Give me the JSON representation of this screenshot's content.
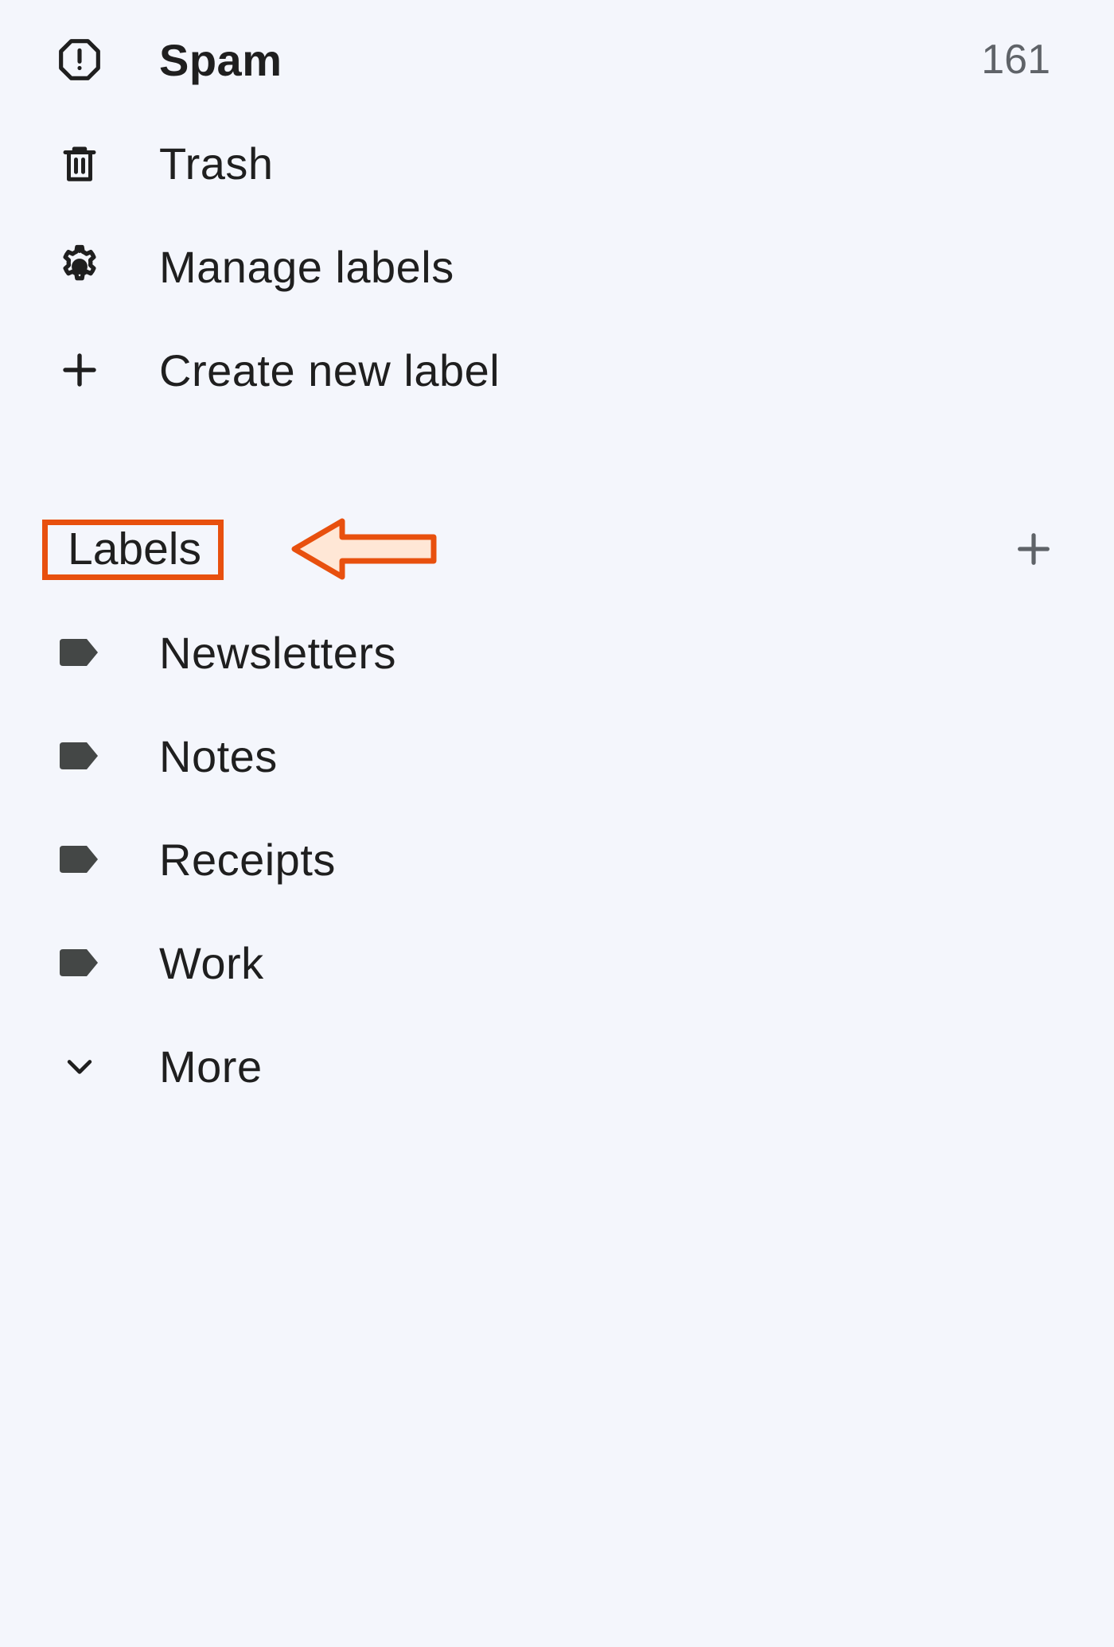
{
  "nav": {
    "spam": {
      "label": "Spam",
      "count": "161"
    },
    "trash": {
      "label": "Trash"
    },
    "manage": {
      "label": "Manage labels"
    },
    "create": {
      "label": "Create new label"
    }
  },
  "section": {
    "title": "Labels"
  },
  "labels": {
    "newsletters": {
      "label": "Newsletters"
    },
    "notes": {
      "label": "Notes"
    },
    "receipts": {
      "label": "Receipts"
    },
    "work": {
      "label": "Work"
    },
    "more": {
      "label": "More"
    }
  }
}
